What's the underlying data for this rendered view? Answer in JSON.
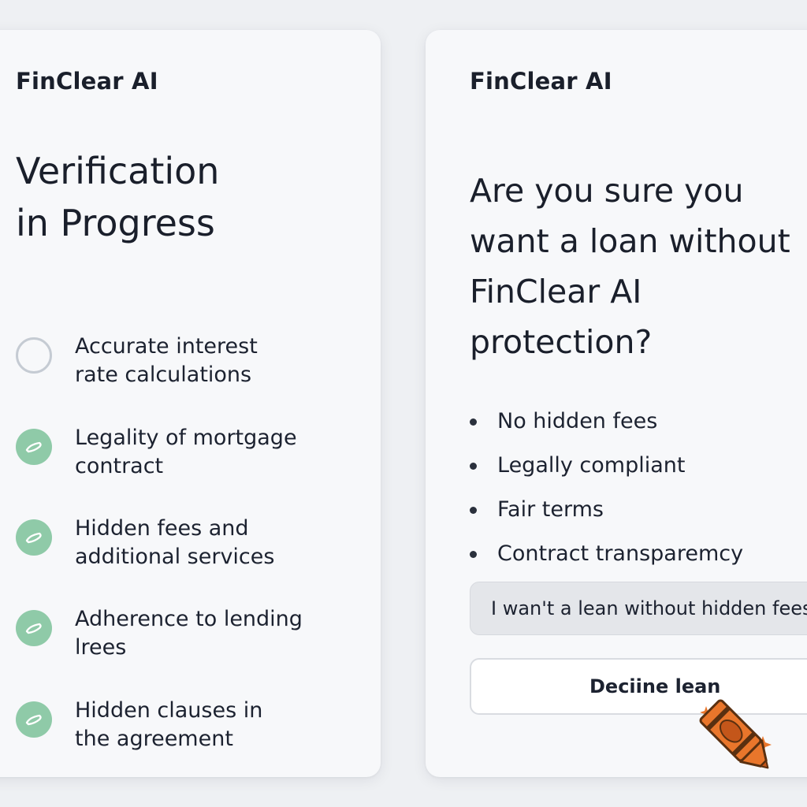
{
  "left_panel": {
    "brand": "FinClear AI",
    "title_line1": "Verification",
    "title_line2": "in Progress",
    "checks": [
      {
        "line1": "Accurate interest",
        "line2": "rate calculations",
        "state": "pending",
        "icon": "empty-circle-icon"
      },
      {
        "line1": "Legality of mortgage",
        "line2": "contract",
        "state": "done",
        "icon": "check-circle-icon"
      },
      {
        "line1": "Hidden fees and",
        "line2": "additional services",
        "state": "done",
        "icon": "check-circle-icon"
      },
      {
        "line1": "Adherence to lending",
        "line2": "lrees",
        "state": "done",
        "icon": "check-circle-icon"
      },
      {
        "line1": "Hidden clauses in",
        "line2": "the agreement",
        "state": "done",
        "icon": "check-circle-icon"
      }
    ]
  },
  "right_panel": {
    "brand": "FinClear AI",
    "question_line1": "Are you sure you",
    "question_line2": "want a loan without",
    "question_line3": "FinClear AI",
    "question_line4": "protection?",
    "benefits": [
      "No hidden fees",
      "Legally compliant",
      "Fair terms",
      "Contract transparemcy"
    ],
    "primary_button": "I wan't a lean without hidden fees",
    "secondary_button": "Deciine lean"
  },
  "decoration": {
    "icon": "crayon-icon"
  },
  "colors": {
    "background": "#eef0f3",
    "card": "#f7f8fa",
    "check_done": "#8fcaa8",
    "check_pending_border": "#c5cbd3",
    "crayon": "#e9762b",
    "text": "#1c2230"
  }
}
